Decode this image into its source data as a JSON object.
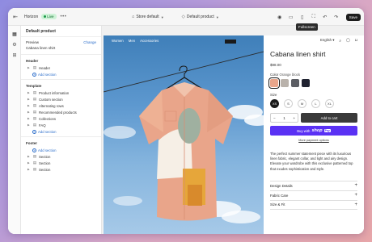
{
  "topbar": {
    "theme_name": "Horizon",
    "live_badge": "Live",
    "more": "•••",
    "store_select": "Store default",
    "product_select": "Default product",
    "save_label": "Save",
    "tooltip": "Fullscreen"
  },
  "sidebar": {
    "title": "Default product",
    "preview_label": "Preview",
    "preview_value": "Cabana linen shirt",
    "change_label": "Change",
    "header": {
      "title": "Header",
      "items": [
        {
          "label": "Header"
        }
      ],
      "add_label": "Add section"
    },
    "template": {
      "title": "Template",
      "items": [
        {
          "label": "Product information"
        },
        {
          "label": "Custom section"
        },
        {
          "label": "Alternating rows"
        },
        {
          "label": "Recommended products"
        },
        {
          "label": "Collections"
        },
        {
          "label": "FAQ"
        }
      ],
      "add_label": "Add section"
    },
    "footer": {
      "title": "Footer",
      "add_label": "Add section",
      "items": [
        {
          "label": "Section"
        },
        {
          "label": "Section"
        },
        {
          "label": "Section"
        }
      ]
    }
  },
  "storefront": {
    "nav": [
      "Women",
      "Men",
      "Accessories"
    ],
    "language": "English",
    "product": {
      "title": "Cabana linen shirt",
      "price": "$98.00",
      "color_label": "Color",
      "color_value": "Orange block",
      "size_label": "Size",
      "sizes": [
        "XS",
        "S",
        "M",
        "L",
        "XL"
      ],
      "selected_size": "XS",
      "quantity": "1",
      "qty_minus": "−",
      "qty_plus": "+",
      "add_to_cart": "Add to cart",
      "buy_with": "Buy with",
      "shop_word": "shop",
      "pay_word": "Pay",
      "more_payment": "More payment options",
      "description": "The perfect summer statement piece with its luxurious linen fabric, elegant collar, and light and airy design. Elevate your wardrobe with this exclusive patterned top that exudes sophistication and style.",
      "accordion": [
        {
          "label": "Design Details"
        },
        {
          "label": "Fabric Care"
        },
        {
          "label": "Size & Fit"
        }
      ]
    },
    "swatch_colors": [
      "#e9a58a",
      "#b9b2ab",
      "#5b5d63",
      "#1f2230"
    ]
  }
}
